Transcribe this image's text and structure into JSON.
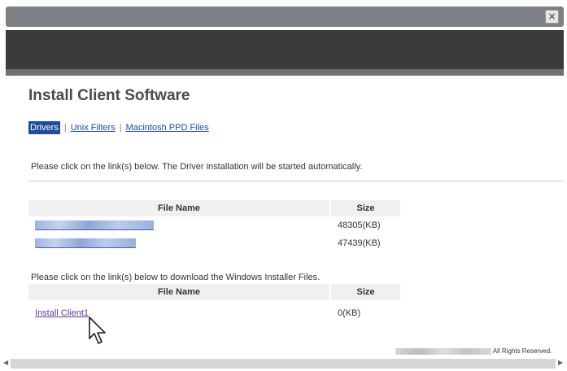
{
  "window": {
    "close_label": "×"
  },
  "page": {
    "title": "Install Client Software",
    "tabs": [
      {
        "label": "Drivers",
        "active": true
      },
      {
        "label": "Unix Filters",
        "active": false
      },
      {
        "label": "Macintosh PPD Files",
        "active": false
      }
    ],
    "tab_separator": "|",
    "instruction_drivers": "Please click on the link(s) below. The Driver installation will be started automatically.",
    "drivers_table": {
      "headers": [
        "File Name",
        "Size"
      ],
      "rows": [
        {
          "size": "48305(KB)"
        },
        {
          "size": "47439(KB)"
        }
      ]
    },
    "instruction_installer": "Please click on the link(s) below to download the Windows Installer Files.",
    "installer_table": {
      "headers": [
        "File Name",
        "Size"
      ],
      "rows": [
        {
          "name": "Install Client1",
          "size": "0(KB)"
        }
      ]
    },
    "footer_text": "All Rights Reserved."
  },
  "icons": {
    "close": "close-icon",
    "cursor": "mouse-pointer-icon",
    "scroll_left": "scroll-left-arrow-icon",
    "scroll_right": "scroll-right-arrow-icon"
  },
  "colors": {
    "titlebar": "#7c7f83",
    "banner": "#3b3b3b",
    "active_tab": "#1f4e9b",
    "link": "#1d4ca0",
    "visited_link": "#5b3e96"
  }
}
